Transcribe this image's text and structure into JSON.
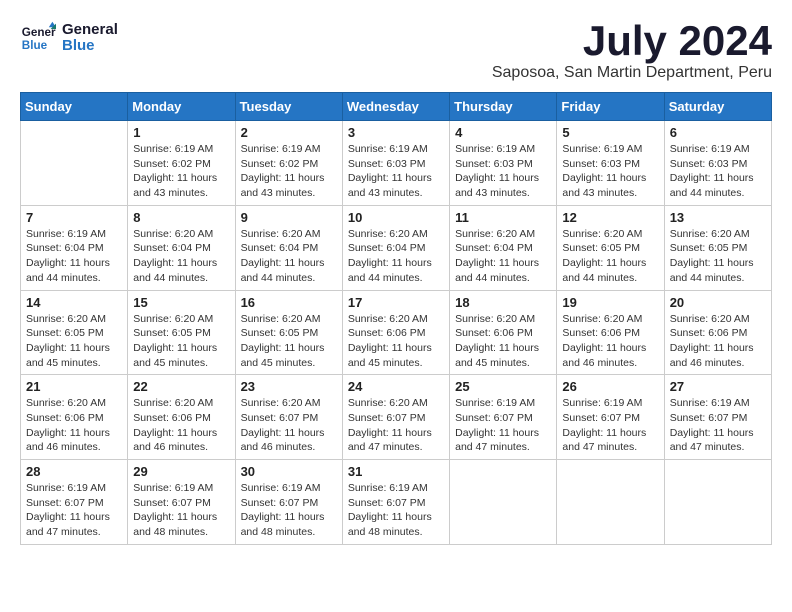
{
  "header": {
    "logo_line1": "General",
    "logo_line2": "Blue",
    "month_year": "July 2024",
    "location": "Saposoa, San Martin Department, Peru"
  },
  "weekdays": [
    "Sunday",
    "Monday",
    "Tuesday",
    "Wednesday",
    "Thursday",
    "Friday",
    "Saturday"
  ],
  "weeks": [
    [
      {
        "day": "",
        "sunrise": "",
        "sunset": "",
        "daylight": ""
      },
      {
        "day": "1",
        "sunrise": "Sunrise: 6:19 AM",
        "sunset": "Sunset: 6:02 PM",
        "daylight": "Daylight: 11 hours and 43 minutes."
      },
      {
        "day": "2",
        "sunrise": "Sunrise: 6:19 AM",
        "sunset": "Sunset: 6:02 PM",
        "daylight": "Daylight: 11 hours and 43 minutes."
      },
      {
        "day": "3",
        "sunrise": "Sunrise: 6:19 AM",
        "sunset": "Sunset: 6:03 PM",
        "daylight": "Daylight: 11 hours and 43 minutes."
      },
      {
        "day": "4",
        "sunrise": "Sunrise: 6:19 AM",
        "sunset": "Sunset: 6:03 PM",
        "daylight": "Daylight: 11 hours and 43 minutes."
      },
      {
        "day": "5",
        "sunrise": "Sunrise: 6:19 AM",
        "sunset": "Sunset: 6:03 PM",
        "daylight": "Daylight: 11 hours and 43 minutes."
      },
      {
        "day": "6",
        "sunrise": "Sunrise: 6:19 AM",
        "sunset": "Sunset: 6:03 PM",
        "daylight": "Daylight: 11 hours and 44 minutes."
      }
    ],
    [
      {
        "day": "7",
        "sunrise": "Sunrise: 6:19 AM",
        "sunset": "Sunset: 6:04 PM",
        "daylight": "Daylight: 11 hours and 44 minutes."
      },
      {
        "day": "8",
        "sunrise": "Sunrise: 6:20 AM",
        "sunset": "Sunset: 6:04 PM",
        "daylight": "Daylight: 11 hours and 44 minutes."
      },
      {
        "day": "9",
        "sunrise": "Sunrise: 6:20 AM",
        "sunset": "Sunset: 6:04 PM",
        "daylight": "Daylight: 11 hours and 44 minutes."
      },
      {
        "day": "10",
        "sunrise": "Sunrise: 6:20 AM",
        "sunset": "Sunset: 6:04 PM",
        "daylight": "Daylight: 11 hours and 44 minutes."
      },
      {
        "day": "11",
        "sunrise": "Sunrise: 6:20 AM",
        "sunset": "Sunset: 6:04 PM",
        "daylight": "Daylight: 11 hours and 44 minutes."
      },
      {
        "day": "12",
        "sunrise": "Sunrise: 6:20 AM",
        "sunset": "Sunset: 6:05 PM",
        "daylight": "Daylight: 11 hours and 44 minutes."
      },
      {
        "day": "13",
        "sunrise": "Sunrise: 6:20 AM",
        "sunset": "Sunset: 6:05 PM",
        "daylight": "Daylight: 11 hours and 44 minutes."
      }
    ],
    [
      {
        "day": "14",
        "sunrise": "Sunrise: 6:20 AM",
        "sunset": "Sunset: 6:05 PM",
        "daylight": "Daylight: 11 hours and 45 minutes."
      },
      {
        "day": "15",
        "sunrise": "Sunrise: 6:20 AM",
        "sunset": "Sunset: 6:05 PM",
        "daylight": "Daylight: 11 hours and 45 minutes."
      },
      {
        "day": "16",
        "sunrise": "Sunrise: 6:20 AM",
        "sunset": "Sunset: 6:05 PM",
        "daylight": "Daylight: 11 hours and 45 minutes."
      },
      {
        "day": "17",
        "sunrise": "Sunrise: 6:20 AM",
        "sunset": "Sunset: 6:06 PM",
        "daylight": "Daylight: 11 hours and 45 minutes."
      },
      {
        "day": "18",
        "sunrise": "Sunrise: 6:20 AM",
        "sunset": "Sunset: 6:06 PM",
        "daylight": "Daylight: 11 hours and 45 minutes."
      },
      {
        "day": "19",
        "sunrise": "Sunrise: 6:20 AM",
        "sunset": "Sunset: 6:06 PM",
        "daylight": "Daylight: 11 hours and 46 minutes."
      },
      {
        "day": "20",
        "sunrise": "Sunrise: 6:20 AM",
        "sunset": "Sunset: 6:06 PM",
        "daylight": "Daylight: 11 hours and 46 minutes."
      }
    ],
    [
      {
        "day": "21",
        "sunrise": "Sunrise: 6:20 AM",
        "sunset": "Sunset: 6:06 PM",
        "daylight": "Daylight: 11 hours and 46 minutes."
      },
      {
        "day": "22",
        "sunrise": "Sunrise: 6:20 AM",
        "sunset": "Sunset: 6:06 PM",
        "daylight": "Daylight: 11 hours and 46 minutes."
      },
      {
        "day": "23",
        "sunrise": "Sunrise: 6:20 AM",
        "sunset": "Sunset: 6:07 PM",
        "daylight": "Daylight: 11 hours and 46 minutes."
      },
      {
        "day": "24",
        "sunrise": "Sunrise: 6:20 AM",
        "sunset": "Sunset: 6:07 PM",
        "daylight": "Daylight: 11 hours and 47 minutes."
      },
      {
        "day": "25",
        "sunrise": "Sunrise: 6:19 AM",
        "sunset": "Sunset: 6:07 PM",
        "daylight": "Daylight: 11 hours and 47 minutes."
      },
      {
        "day": "26",
        "sunrise": "Sunrise: 6:19 AM",
        "sunset": "Sunset: 6:07 PM",
        "daylight": "Daylight: 11 hours and 47 minutes."
      },
      {
        "day": "27",
        "sunrise": "Sunrise: 6:19 AM",
        "sunset": "Sunset: 6:07 PM",
        "daylight": "Daylight: 11 hours and 47 minutes."
      }
    ],
    [
      {
        "day": "28",
        "sunrise": "Sunrise: 6:19 AM",
        "sunset": "Sunset: 6:07 PM",
        "daylight": "Daylight: 11 hours and 47 minutes."
      },
      {
        "day": "29",
        "sunrise": "Sunrise: 6:19 AM",
        "sunset": "Sunset: 6:07 PM",
        "daylight": "Daylight: 11 hours and 48 minutes."
      },
      {
        "day": "30",
        "sunrise": "Sunrise: 6:19 AM",
        "sunset": "Sunset: 6:07 PM",
        "daylight": "Daylight: 11 hours and 48 minutes."
      },
      {
        "day": "31",
        "sunrise": "Sunrise: 6:19 AM",
        "sunset": "Sunset: 6:07 PM",
        "daylight": "Daylight: 11 hours and 48 minutes."
      },
      {
        "day": "",
        "sunrise": "",
        "sunset": "",
        "daylight": ""
      },
      {
        "day": "",
        "sunrise": "",
        "sunset": "",
        "daylight": ""
      },
      {
        "day": "",
        "sunrise": "",
        "sunset": "",
        "daylight": ""
      }
    ]
  ]
}
